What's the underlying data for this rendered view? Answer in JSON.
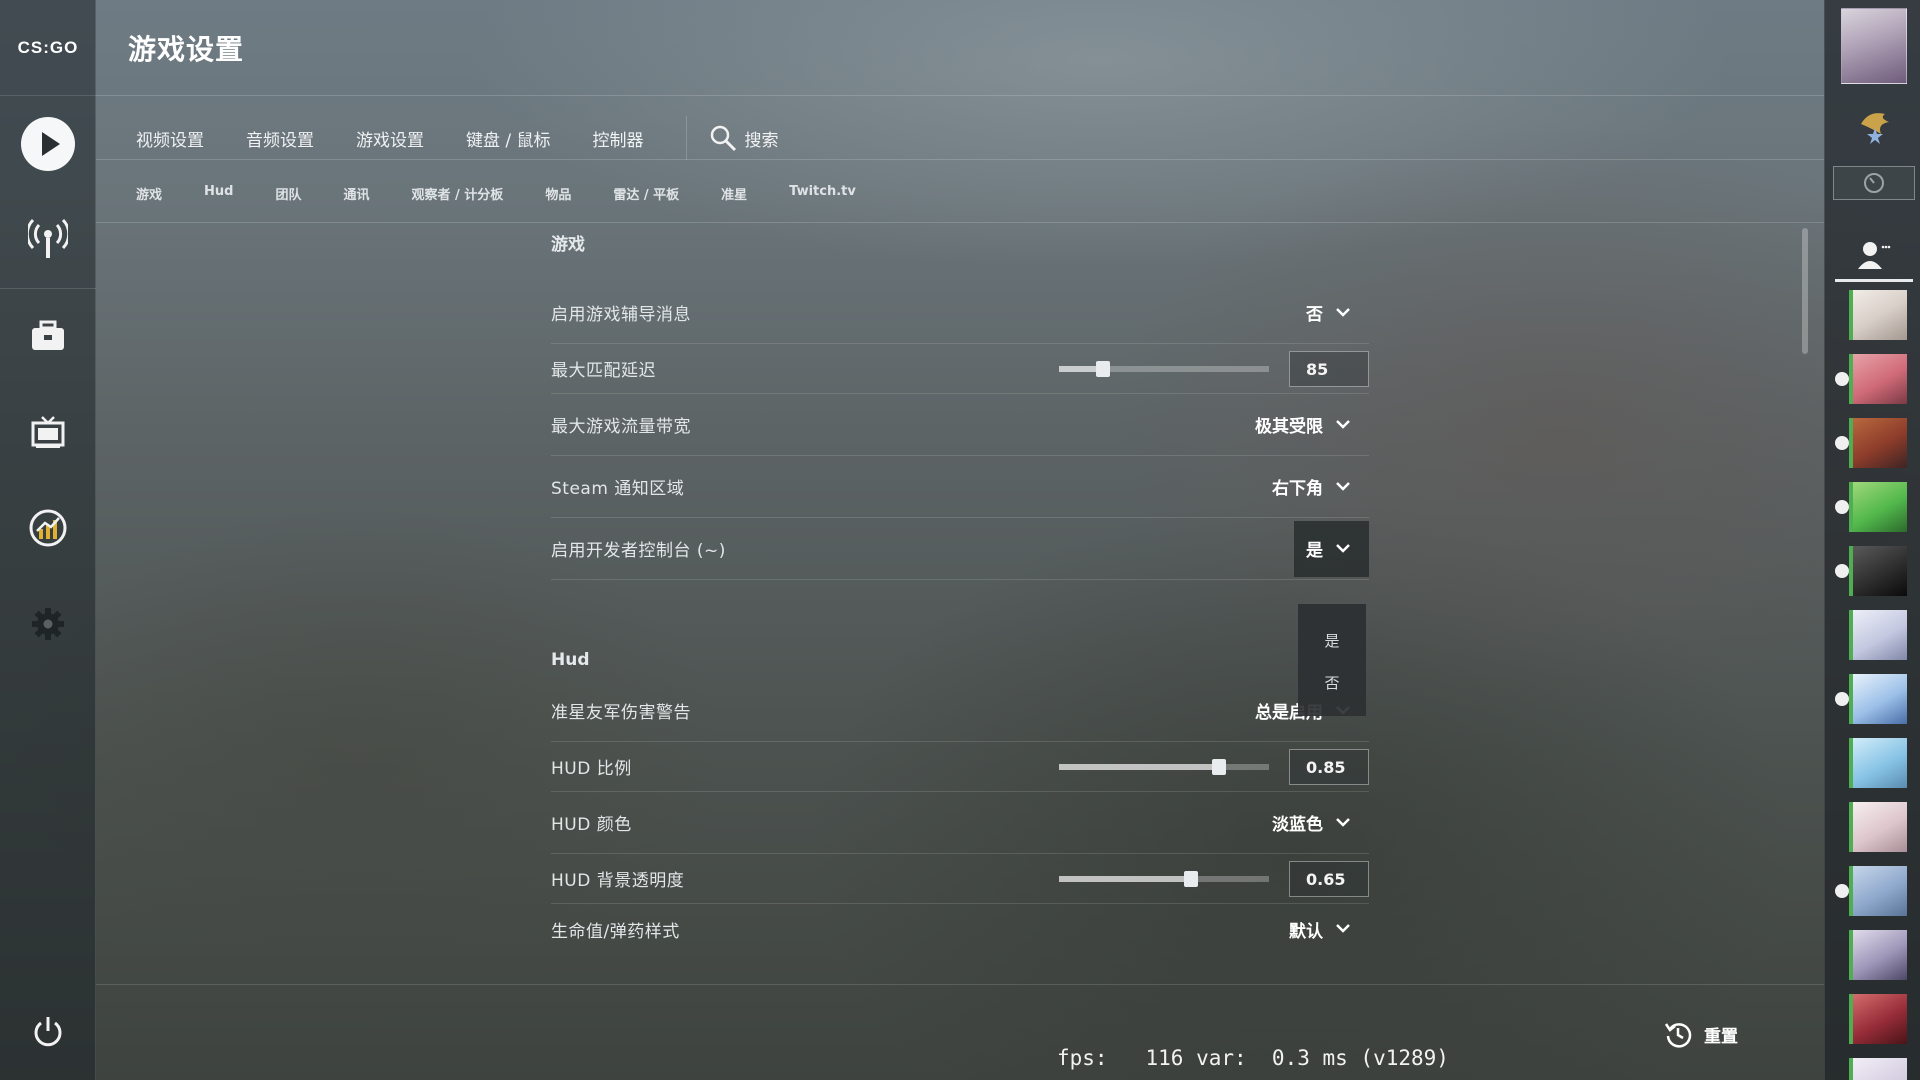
{
  "app": {
    "logo": "CS:GO",
    "title": "游戏设置"
  },
  "nav": {
    "tabs": [
      "视频设置",
      "音频设置",
      "游戏设置",
      "键盘 / 鼠标",
      "控制器"
    ],
    "search_label": "搜索"
  },
  "subnav": [
    "游戏",
    "Hud",
    "团队",
    "通讯",
    "观察者 / 计分板",
    "物品",
    "雷达 / 平板",
    "准星",
    "Twitch.tv"
  ],
  "sections": {
    "game": {
      "title": "游戏",
      "rows": [
        {
          "label": "启用游戏辅导消息",
          "type": "dropdown",
          "value": "否"
        },
        {
          "label": "最大匹配延迟",
          "type": "slider",
          "value": "85",
          "fraction": 0.21
        },
        {
          "label": "最大游戏流量带宽",
          "type": "dropdown",
          "value": "极其受限"
        },
        {
          "label": "Steam 通知区域",
          "type": "dropdown",
          "value": "右下角"
        },
        {
          "label": "启用开发者控制台 (~)",
          "type": "dropdown",
          "value": "是",
          "open": true
        }
      ]
    },
    "hud": {
      "title": "Hud",
      "rows": [
        {
          "label": "准星友军伤害警告",
          "type": "dropdown",
          "value": "总是启用"
        },
        {
          "label": "HUD 比例",
          "type": "slider",
          "value": "0.85",
          "fraction": 0.76
        },
        {
          "label": "HUD 颜色",
          "type": "dropdown",
          "value": "淡蓝色"
        },
        {
          "label": "HUD 背景透明度",
          "type": "slider",
          "value": "0.65",
          "fraction": 0.63
        },
        {
          "label": "生命值/弹药样式",
          "type": "dropdown",
          "value": "默认"
        }
      ]
    }
  },
  "dropdown_menu": {
    "options": [
      "是",
      "否"
    ]
  },
  "footer": {
    "fps_text": "fps:   116 var:  0.3 ms (v1289)",
    "reset_label": "重置"
  },
  "icons": {
    "sidebar": [
      "play-icon",
      "broadcast-icon",
      "inventory-icon",
      "watch-tv-icon",
      "stats-icon",
      "gear-icon",
      "power-icon"
    ],
    "nav": [
      "search-icon"
    ],
    "footer": [
      "history-icon"
    ]
  },
  "colors": {
    "friend_border": "#4fae52"
  }
}
